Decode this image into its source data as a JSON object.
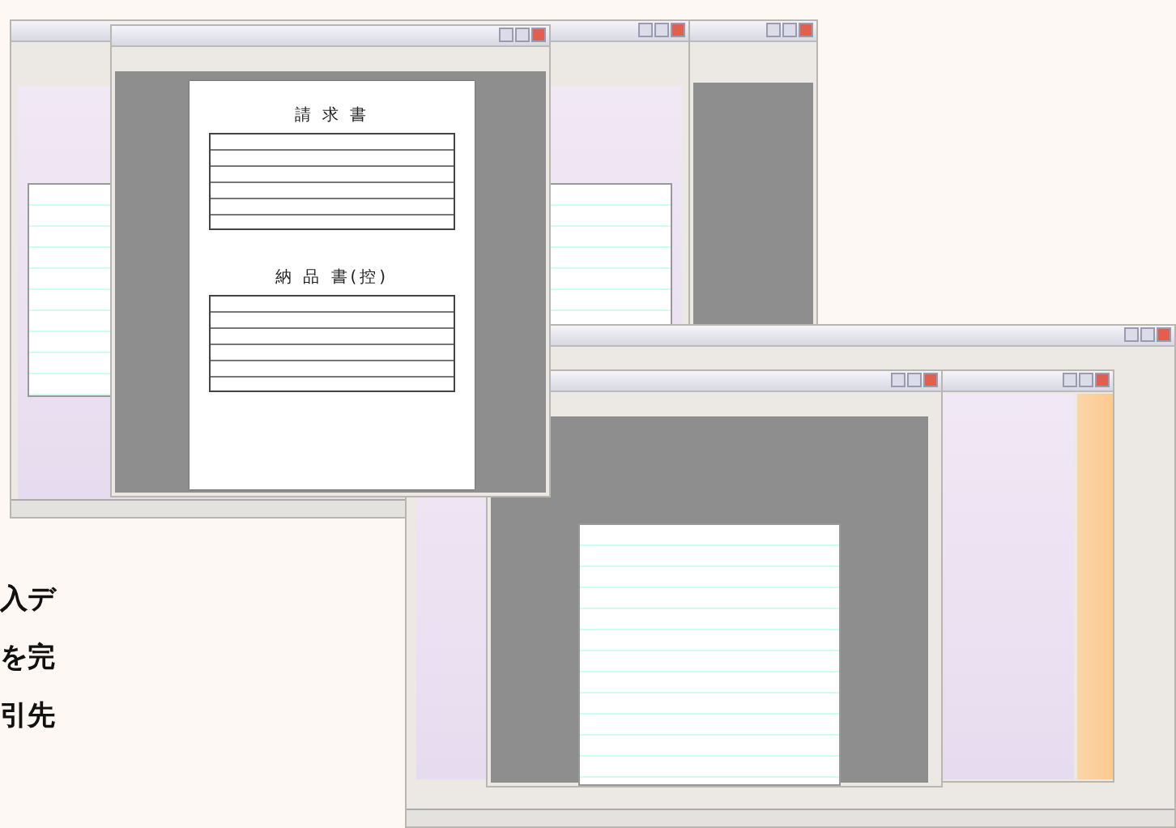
{
  "caption_lines": [
    "入デ",
    "を完",
    "引先"
  ],
  "preview": {
    "documents": [
      {
        "title": "請 求 書"
      },
      {
        "title": "納 品 書(控)"
      }
    ]
  }
}
